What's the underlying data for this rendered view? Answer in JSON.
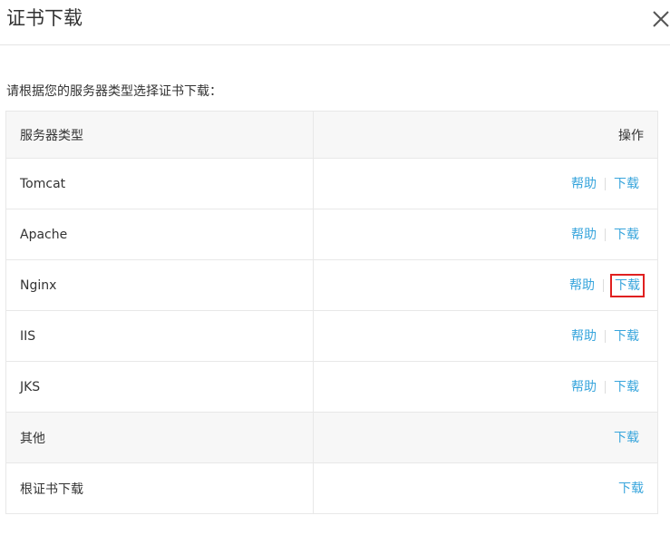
{
  "dialog": {
    "title": "证书下载",
    "instruction": "请根据您的服务器类型选择证书下载："
  },
  "table": {
    "headers": {
      "type": "服务器类型",
      "action": "操作"
    },
    "rows": [
      {
        "name": "Tomcat",
        "help": "帮助",
        "download": "下载"
      },
      {
        "name": "Apache",
        "help": "帮助",
        "download": "下载"
      },
      {
        "name": "Nginx",
        "help": "帮助",
        "download": "下载"
      },
      {
        "name": "IIS",
        "help": "帮助",
        "download": "下载"
      },
      {
        "name": "JKS",
        "help": "帮助",
        "download": "下载"
      },
      {
        "name": "其他",
        "download": "下载"
      },
      {
        "name": "根证书下载",
        "download": "下载"
      }
    ]
  },
  "colors": {
    "link": "#38a5dc",
    "highlight": "#e02020",
    "header_bg": "#f7f7f7",
    "border": "#e8e8e8"
  },
  "icons": {
    "close": "close-icon"
  }
}
